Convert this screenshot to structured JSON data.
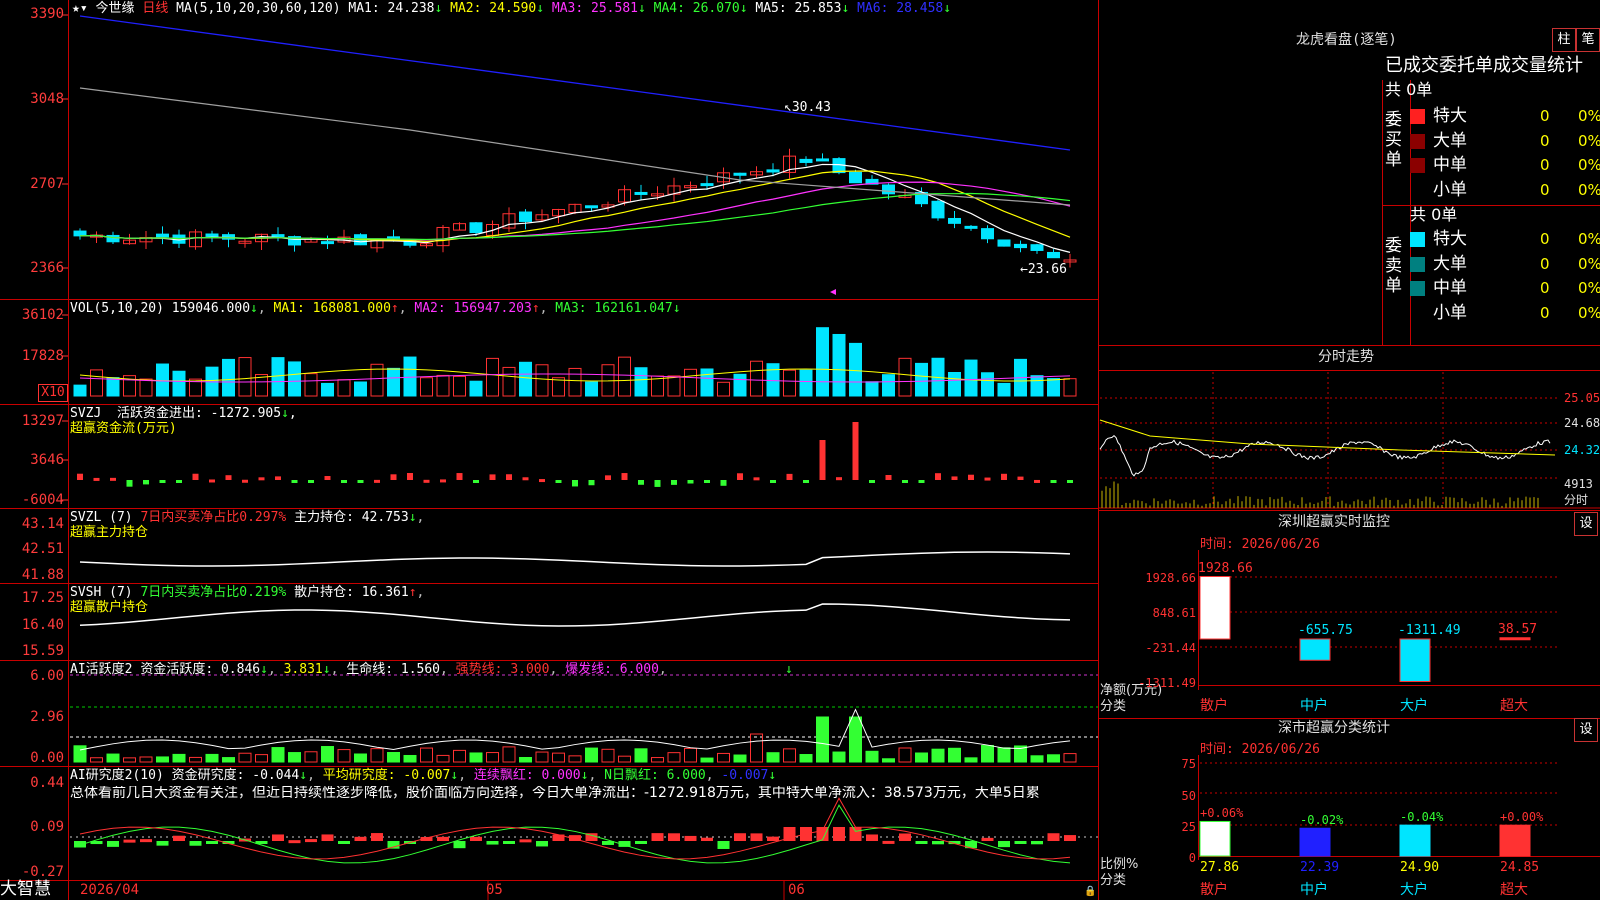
{
  "colors": {
    "up": "#ff3232",
    "down": "#00e5ff",
    "grid": "#c80000",
    "white": "#ffffff",
    "yellow": "#ffff00",
    "magenta": "#ff33ff",
    "green": "#33ff33",
    "blue": "#2020ff",
    "gray": "#a0a0a0",
    "teal": "#008080",
    "darkred": "#8b0000"
  },
  "main": {
    "title": "今世缘",
    "period": "日线",
    "ma_label": "MA(5,10,20,30,60,120)",
    "ma1": "MA1: 24.238",
    "ma2": "MA2: 24.590",
    "ma3": "MA3: 25.581",
    "ma4": "MA4: 26.070",
    "ma5": "MA5: 25.853",
    "ma6": "MA6: 28.458",
    "y_ticks": [
      "3390",
      "3048",
      "2707",
      "2366"
    ],
    "high_label": "30.43",
    "low_label": "←23.66"
  },
  "vol": {
    "label": "VOL(5,10,20)",
    "value": "159046.000",
    "ma1": "MA1: 168081.000",
    "ma2": "MA2: 156947.203",
    "ma3": "MA3: 162161.047",
    "y_ticks": [
      "36102",
      "17828"
    ],
    "unit": "X10"
  },
  "svzj": {
    "label": "SVZJ",
    "desc": "活跃资金进出: -1272.905",
    "sub": "超赢资金流(万元)",
    "y_ticks": [
      "13297",
      "3646",
      "-6004"
    ]
  },
  "svzl": {
    "label": "SVZL (7)",
    "desc": "7日内买卖净占比0.297%",
    "hold": "主力持仓: 42.753",
    "sub": "超赢主力持仓",
    "y_ticks": [
      "43.14",
      "42.51",
      "41.88"
    ]
  },
  "svsh": {
    "label": "SVSH (7)",
    "desc": "7日内买卖净占比0.219%",
    "hold": "散户持仓: 16.361",
    "sub": "超赢散户持仓",
    "y_ticks": [
      "17.25",
      "16.40",
      "15.59"
    ]
  },
  "ai1": {
    "label": "AI活跃度2",
    "a": "资金活跃度: 0.846",
    "b": "3.831",
    "c": "生命线: 1.560",
    "d": "强势线: 3.000",
    "e": "爆发线: 6.000",
    "y_ticks": [
      "6.00",
      "2.96",
      "0.00"
    ]
  },
  "ai2": {
    "label": "AI研究度2(10)",
    "a": "资金研究度: -0.044",
    "b": "平均研究度: -0.007",
    "c": "连续飘红: 0.000",
    "d": "N日飘红: 6.000",
    "e": "-0.007",
    "text": "总体看前几日大资金有关注，但近日持续性逐步降低，股价面临方向选择，今日大单净流出：-1272.918万元，其中特大单净流入：38.573万元，大单5日累",
    "y_ticks": [
      "0.44",
      "0.09",
      "-0.27"
    ]
  },
  "xaxis": {
    "labels": [
      "2026/04",
      "05",
      "06"
    ]
  },
  "brand": "大智慧",
  "right": {
    "lhb_title": "龙虎看盘(逐笔)",
    "btn1": "柱",
    "btn2": "笔",
    "stat_title": "已成交委托单成交量统计",
    "buy": {
      "side": "委买单",
      "total": "共 0单",
      "rows": [
        {
          "name": "特大",
          "n": "0",
          "p": "0%"
        },
        {
          "name": "大单",
          "n": "0",
          "p": "0%"
        },
        {
          "name": "中单",
          "n": "0",
          "p": "0%"
        },
        {
          "name": "小单",
          "n": "0",
          "p": "0%"
        }
      ]
    },
    "sell": {
      "side": "委卖单",
      "total": "共 0单",
      "rows": [
        {
          "name": "特大",
          "n": "0",
          "p": "0%"
        },
        {
          "name": "大单",
          "n": "0",
          "p": "0%"
        },
        {
          "name": "中单",
          "n": "0",
          "p": "0%"
        },
        {
          "name": "小单",
          "n": "0",
          "p": "0%"
        }
      ]
    },
    "fs_title": "分时走势",
    "fs_ticks": [
      "25.05",
      "24.68",
      "24.32",
      "4913",
      "分时"
    ],
    "mon_title": "深圳超赢实时监控",
    "mon_time": "时间: 2026/06/26",
    "set_btn": "设",
    "mon_ticks": [
      "1928.66",
      "848.61",
      "-231.44",
      "-1311.49"
    ],
    "mon_ylabel": "净额(万元)",
    "mon_xlabel": "分类",
    "mon_values": [
      "1928.66",
      "-655.75",
      "-1311.49",
      "38.57"
    ],
    "mon_cats": [
      "散户",
      "中户",
      "大户",
      "超大"
    ],
    "cls_title": "深市超赢分类统计",
    "cls_time": "时间: 2026/06/26",
    "cls_ticks": [
      "75",
      "50",
      "25",
      "0"
    ],
    "cls_ylabel": "比例%",
    "cls_xlabel": "分类",
    "cls_changes": [
      "+0.06%",
      "-0.02%",
      "-0.04%",
      "+0.00%"
    ],
    "cls_values": [
      "27.86",
      "22.39",
      "24.90",
      "24.85"
    ]
  },
  "chart_data": {
    "type": "candlestick",
    "title": "今世缘 日线",
    "mon_chart": {
      "type": "bar",
      "categories": [
        "散户",
        "中户",
        "大户",
        "超大"
      ],
      "values": [
        1928.66,
        -655.75,
        -1311.49,
        38.57
      ],
      "ylim": [
        -1311.49,
        1928.66
      ]
    },
    "cls_chart": {
      "type": "bar",
      "categories": [
        "散户",
        "中户",
        "大户",
        "超大"
      ],
      "values": [
        27.86,
        22.39,
        24.9,
        24.85
      ],
      "ylim": [
        0,
        75
      ]
    }
  }
}
